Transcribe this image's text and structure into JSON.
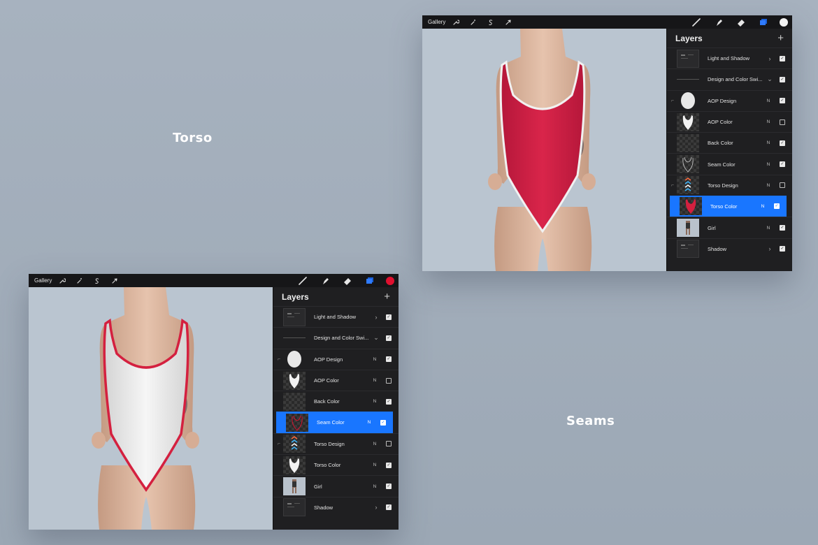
{
  "captions": {
    "torso": "Torso",
    "seams": "Seams"
  },
  "toolbar": {
    "gallery_label": "Gallery",
    "left_tools": [
      "wrench-icon",
      "magic-wand-icon",
      "selection-s-icon",
      "arrow-cursor-icon"
    ],
    "right_tools": [
      "brush-icon",
      "smudge-icon",
      "eraser-icon",
      "layers-icon"
    ]
  },
  "colors": {
    "torso_active_color": "#f2f2f2",
    "seams_active_color": "#e0102f",
    "selection_blue": "#1976ff",
    "swimsuit_red": "#d4203f",
    "swimsuit_white": "#f1f1f1"
  },
  "torso_panel": {
    "title": "Layers",
    "add_label": "+",
    "layers": [
      {
        "name": "Light and Shadow",
        "mode": "",
        "chevron": ">",
        "visible": true,
        "thumb": "group",
        "clipped": false
      },
      {
        "name": "Design and Color Swi...",
        "mode": "",
        "chevron": "v",
        "visible": true,
        "thumb": "line",
        "clipped": false
      },
      {
        "name": "AOP Design",
        "mode": "N",
        "chevron": "",
        "visible": true,
        "thumb": "oval",
        "clipped": true
      },
      {
        "name": "AOP Color",
        "mode": "N",
        "chevron": "",
        "visible": false,
        "thumb": "suit-white",
        "clipped": false
      },
      {
        "name": "Back Color",
        "mode": "N",
        "chevron": "",
        "visible": true,
        "thumb": "checker",
        "clipped": false
      },
      {
        "name": "Seam Color",
        "mode": "N",
        "chevron": "",
        "visible": true,
        "thumb": "seam",
        "clipped": false
      },
      {
        "name": "Torso Design",
        "mode": "N",
        "chevron": "",
        "visible": false,
        "thumb": "chevrons",
        "clipped": true
      },
      {
        "name": "Torso Color",
        "mode": "N",
        "chevron": "",
        "visible": true,
        "thumb": "suit-red",
        "clipped": false,
        "selected": true
      },
      {
        "name": "Girl",
        "mode": "N",
        "chevron": "",
        "visible": true,
        "thumb": "girl",
        "clipped": false
      },
      {
        "name": "Shadow",
        "mode": "",
        "chevron": ">",
        "visible": true,
        "thumb": "group",
        "clipped": false
      }
    ]
  },
  "seams_panel": {
    "title": "Layers",
    "add_label": "+",
    "layers": [
      {
        "name": "Light and Shadow",
        "mode": "",
        "chevron": ">",
        "visible": true,
        "thumb": "group",
        "clipped": false
      },
      {
        "name": "Design and Color Swi...",
        "mode": "",
        "chevron": "v",
        "visible": true,
        "thumb": "line",
        "clipped": false
      },
      {
        "name": "AOP Design",
        "mode": "N",
        "chevron": "",
        "visible": true,
        "thumb": "oval",
        "clipped": true
      },
      {
        "name": "AOP Color",
        "mode": "N",
        "chevron": "",
        "visible": false,
        "thumb": "suit-white",
        "clipped": false
      },
      {
        "name": "Back Color",
        "mode": "N",
        "chevron": "",
        "visible": true,
        "thumb": "checker",
        "clipped": false
      },
      {
        "name": "Seam Color",
        "mode": "N",
        "chevron": "",
        "visible": true,
        "thumb": "seam-red",
        "clipped": false,
        "selected": true
      },
      {
        "name": "Torso Design",
        "mode": "N",
        "chevron": "",
        "visible": false,
        "thumb": "chevrons",
        "clipped": true
      },
      {
        "name": "Torso Color",
        "mode": "N",
        "chevron": "",
        "visible": true,
        "thumb": "suit-white",
        "clipped": false
      },
      {
        "name": "Girl",
        "mode": "N",
        "chevron": "",
        "visible": true,
        "thumb": "girl",
        "clipped": false
      },
      {
        "name": "Shadow",
        "mode": "",
        "chevron": ">",
        "visible": true,
        "thumb": "group",
        "clipped": false
      }
    ]
  }
}
